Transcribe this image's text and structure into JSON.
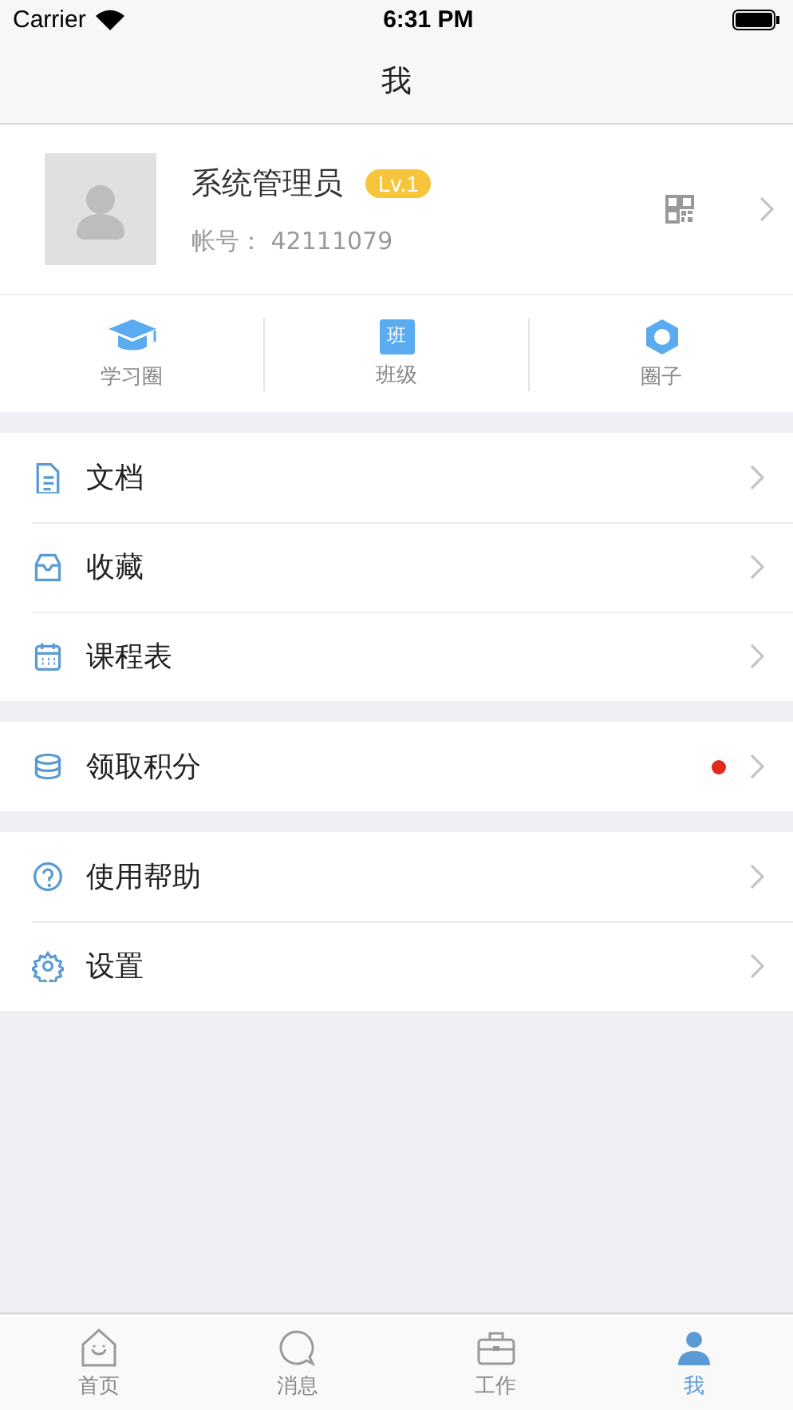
{
  "status_bar": {
    "carrier": "Carrier",
    "time": "6:31 PM"
  },
  "nav": {
    "title": "我"
  },
  "profile": {
    "name": "系统管理员",
    "level_badge": "Lv.1",
    "account": "帐号：  42111079"
  },
  "shortcuts": [
    {
      "kind": "cap",
      "label": "学习圈"
    },
    {
      "kind": "class",
      "label": "班级",
      "icon_text": "班"
    },
    {
      "kind": "hex",
      "label": "圈子"
    }
  ],
  "menu_groups": [
    [
      {
        "kind": "doc",
        "label": "文档",
        "dot": false
      },
      {
        "kind": "inbox",
        "label": "收藏",
        "dot": false
      },
      {
        "kind": "calendar",
        "label": "课程表",
        "dot": false
      }
    ],
    [
      {
        "kind": "coins",
        "label": "领取积分",
        "dot": true
      }
    ],
    [
      {
        "kind": "help",
        "label": "使用帮助",
        "dot": false
      },
      {
        "kind": "gear",
        "label": "设置",
        "dot": false
      }
    ]
  ],
  "tabs": [
    {
      "kind": "home",
      "label": "首页",
      "selected": false
    },
    {
      "kind": "chat",
      "label": "消息",
      "selected": false
    },
    {
      "kind": "work",
      "label": "工作",
      "selected": false
    },
    {
      "kind": "me",
      "label": "我",
      "selected": true
    }
  ]
}
